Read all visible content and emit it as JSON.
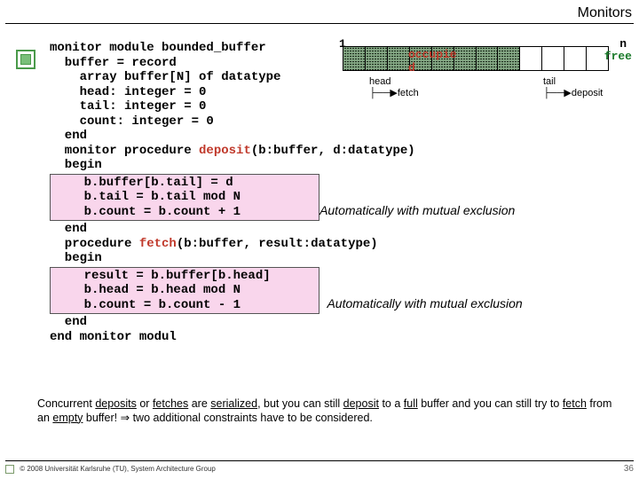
{
  "header": {
    "title": "Monitors"
  },
  "code": {
    "l1": "monitor module bounded_buffer",
    "l2": "  buffer = record",
    "l3": "    array buffer[N] of datatype",
    "l4": "    head: integer = 0",
    "l5": "    tail: integer = 0",
    "l6": "    count: integer = 0",
    "l7": "  end",
    "l8a": "  monitor procedure ",
    "l8proc": "deposit",
    "l8b": "(b:buffer, d:datatype)",
    "l9": "  begin",
    "pb1a": "    b.buffer[b.tail] = d",
    "pb1b": "    b.tail = b.tail mod N",
    "pb1c": "    b.count = b.count + 1",
    "l10": "  end",
    "l11a": "  procedure ",
    "l11proc": "fetch",
    "l11b": "(b:buffer, result:datatype)",
    "l12": "  begin",
    "pb2a": "    result = b.buffer[b.head]",
    "pb2b": "    b.head = b.head mod N",
    "pb2c": "    b.count = b.count - 1",
    "l13": "  end",
    "l14": "end monitor modul"
  },
  "mutex": {
    "text1": "Automatically with mutual exclusion",
    "text2": "Automatically with mutual exclusion"
  },
  "diagram": {
    "one": "1",
    "n": "n",
    "occupied": "occupie",
    "occupied2": "d",
    "free": "free",
    "head": "head",
    "fetch": "fetch",
    "tail": "tail",
    "deposit": "deposit"
  },
  "note": {
    "t1": "Concurrent ",
    "u1": "deposits",
    "t2": " or ",
    "u2": "fetches",
    "t3": " are ",
    "u3": "serialized",
    "t4": ", but you can still ",
    "u4": "deposit",
    "t5": " to a ",
    "u5": "full",
    "t6": " buffer and you can still try to ",
    "u6": "fetch",
    "t7": " from an ",
    "u7": "empty",
    "t8": " buffer! ",
    "arrow": "⇒",
    "t9": " two additional constraints have to be considered."
  },
  "footer": {
    "copyright": "© 2008 Universität Karlsruhe (TU), System Architecture Group",
    "page": "36"
  }
}
